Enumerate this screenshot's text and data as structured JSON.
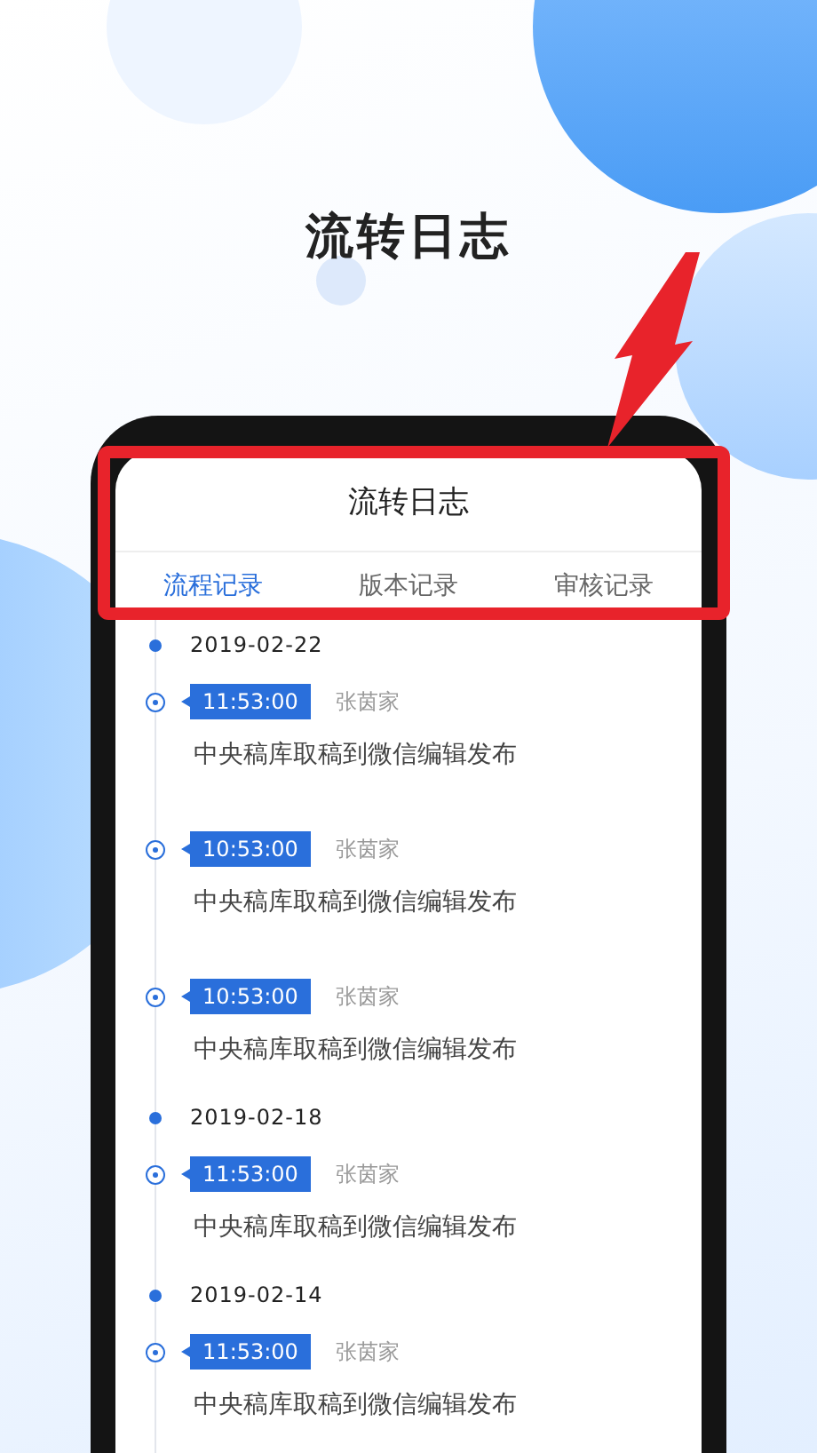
{
  "headline": "流转日志",
  "screen": {
    "title": "流转日志",
    "tabs": [
      {
        "label": "流程记录",
        "selected": true
      },
      {
        "label": "版本记录",
        "selected": false
      },
      {
        "label": "审核记录",
        "selected": false
      }
    ],
    "timeline": [
      {
        "date": "2019-02-22",
        "entries": [
          {
            "time": "11:53:00",
            "user": "张茵家",
            "action": "中央稿库取稿到微信编辑发布"
          },
          {
            "time": "10:53:00",
            "user": "张茵家",
            "action": "中央稿库取稿到微信编辑发布"
          },
          {
            "time": "10:53:00",
            "user": "张茵家",
            "action": "中央稿库取稿到微信编辑发布"
          }
        ]
      },
      {
        "date": "2019-02-18",
        "entries": [
          {
            "time": "11:53:00",
            "user": "张茵家",
            "action": "中央稿库取稿到微信编辑发布"
          }
        ]
      },
      {
        "date": "2019-02-14",
        "entries": [
          {
            "time": "11:53:00",
            "user": "张茵家",
            "action": "中央稿库取稿到微信编辑发布"
          }
        ]
      }
    ]
  },
  "highlight": {
    "shown": true
  }
}
